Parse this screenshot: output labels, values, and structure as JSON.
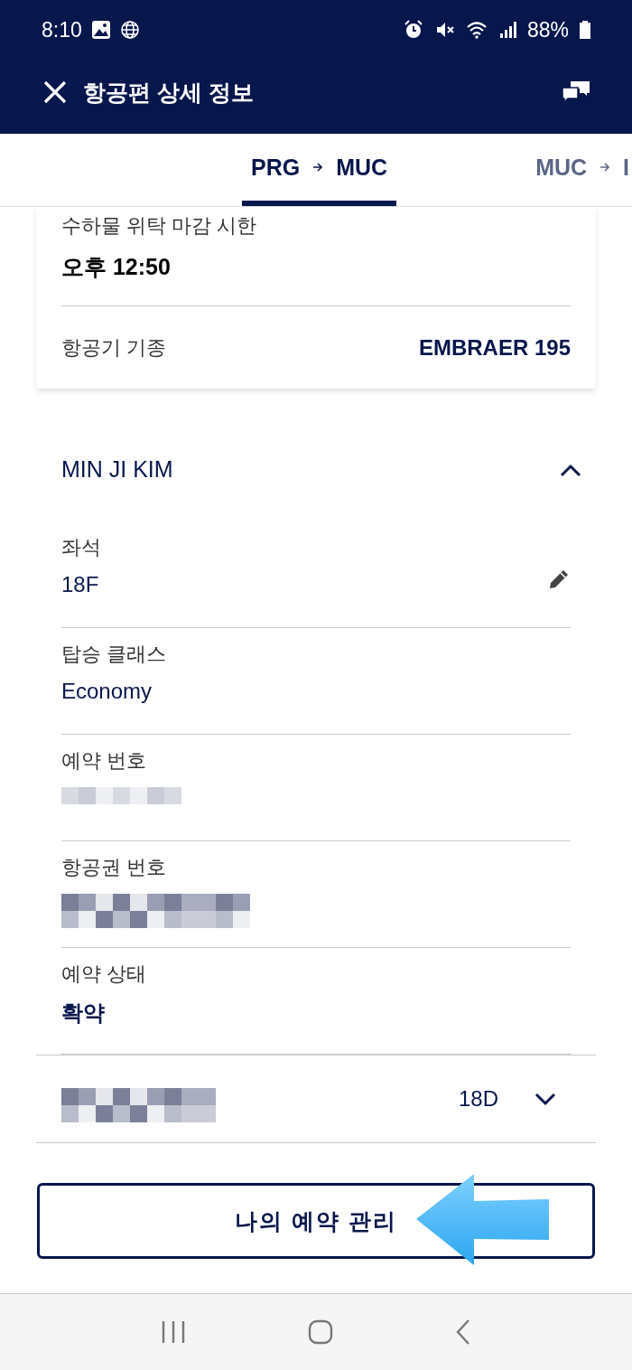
{
  "status_bar": {
    "time": "8:10",
    "battery": "88%"
  },
  "header": {
    "title": "항공편 상세 정보"
  },
  "tabs": [
    {
      "from": "PRG",
      "to": "MUC",
      "selected": true
    },
    {
      "from": "MUC",
      "to": "I",
      "selected": false
    }
  ],
  "flight_card": {
    "rows": [
      {
        "label": "수하물 위탁 마감 시한",
        "value": "오후 12:50",
        "kind": "stacked"
      },
      {
        "label": "항공기 기종",
        "value": "EMBRAER 195",
        "kind": "inline"
      }
    ]
  },
  "passengers": [
    {
      "name": "MIN JI KIM",
      "expanded": true,
      "fields": [
        {
          "label": "좌석",
          "value": "18F",
          "kind": "editable"
        },
        {
          "label": "탑승 클래스",
          "value": "Economy",
          "kind": "text"
        },
        {
          "label": "예약 번호",
          "kind": "redacted"
        },
        {
          "label": "항공권 번호",
          "kind": "redacted"
        },
        {
          "label": "예약 상태",
          "value": "확약",
          "kind": "strong"
        }
      ]
    },
    {
      "kind": "redacted",
      "seat": "18D",
      "expanded": false
    }
  ],
  "manage_button": {
    "label": "나의 예약 관리"
  }
}
